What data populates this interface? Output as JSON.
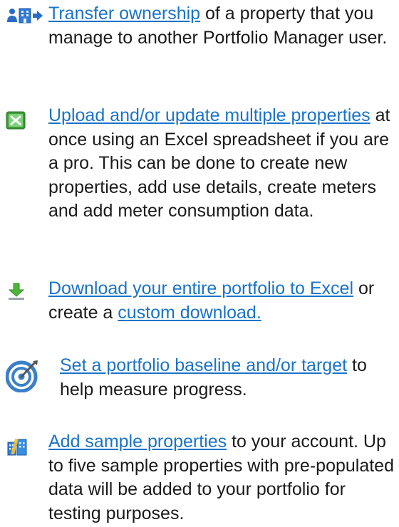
{
  "items": [
    {
      "icon": "building-transfer-icon",
      "link": "Transfer ownership",
      "rest": " of a property that you manage to another Portfolio Manager user."
    },
    {
      "icon": "excel-icon",
      "link": "Upload and/or update multiple properties",
      "rest": " at once using an Excel spreadsheet if you are a pro. This can be done to create new properties, add use details, create meters and add meter consumption data."
    },
    {
      "icon": "download-arrow-icon",
      "link": "Download your entire portfolio to Excel",
      "middle": " or create a ",
      "link2": "custom download."
    },
    {
      "icon": "target-icon",
      "link": "Set a portfolio baseline and/or target",
      "rest": " to help measure progress."
    },
    {
      "icon": "sample-properties-icon",
      "link": "Add sample properties",
      "rest": " to your account. Up to five sample properties with pre-populated data will be added to your portfolio for testing purposes."
    }
  ],
  "colors": {
    "link": "#1a73c8",
    "text": "#1a1a1a"
  }
}
